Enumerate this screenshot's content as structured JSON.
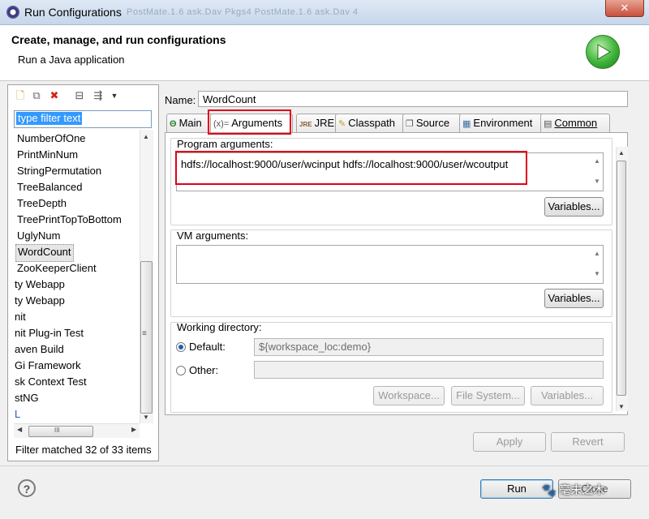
{
  "window": {
    "title": "Run Configurations",
    "ghost_tabs": "PostMate.1.6 ask.Dav    Pkgs4    PostMate.1.6 ask.Dav    4",
    "close_glyph": "✕"
  },
  "header": {
    "title": "Create, manage, and run configurations",
    "subtitle": "Run a Java application"
  },
  "sidebar": {
    "filter_text": "type filter text",
    "items": [
      {
        "label": "NumberOfOne"
      },
      {
        "label": "PrintMinNum"
      },
      {
        "label": "StringPermutation"
      },
      {
        "label": "TreeBalanced"
      },
      {
        "label": "TreeDepth"
      },
      {
        "label": "TreePrintTopToBottom"
      },
      {
        "label": "UglyNum"
      },
      {
        "label": "WordCount"
      },
      {
        "label": "ZooKeeperClient"
      },
      {
        "label": "ty Webapp"
      },
      {
        "label": "ty Webapp"
      },
      {
        "label": "nit"
      },
      {
        "label": "nit Plug-in Test"
      },
      {
        "label": "aven Build"
      },
      {
        "label": "Gi Framework"
      },
      {
        "label": "sk Context Test"
      },
      {
        "label": "stNG"
      },
      {
        "label": "L"
      }
    ],
    "status": "Filter matched 32 of 33 items",
    "hscroll_glyph": "III",
    "vscroll_glyph": "≡"
  },
  "config": {
    "name_label": "Name:",
    "name_value": "WordCount",
    "tabs": [
      {
        "label": "Main"
      },
      {
        "label": "Arguments"
      },
      {
        "label": "JRE"
      },
      {
        "label": "Classpath"
      },
      {
        "label": "Source"
      },
      {
        "label": "Environment"
      },
      {
        "label": "Common"
      }
    ],
    "tab_icons": [
      "Θ",
      "(x)=",
      "JRE",
      "✎",
      "❐",
      "▦",
      "▤"
    ],
    "active_tab": "Arguments"
  },
  "arguments": {
    "program_label": "Program arguments:",
    "program_value": "hdfs://localhost:9000/user/wcinput hdfs://localhost:9000/user/wcoutput",
    "program_variables": "Variables...",
    "vm_label": "VM arguments:",
    "vm_value": "",
    "vm_variables": "Variables...",
    "wd_label": "Working directory:",
    "default_label": "Default:",
    "default_value": "${workspace_loc:demo}",
    "other_label": "Other:",
    "other_value": "",
    "workspace_btn": "Workspace...",
    "filesystem_btn": "File System...",
    "wd_variables_btn": "Variables..."
  },
  "footer": {
    "apply": "Apply",
    "revert": "Revert",
    "run": "Run",
    "close": "Close"
  },
  "watermark": "🐾 毫末之木",
  "highlight_color": "#e0001a"
}
